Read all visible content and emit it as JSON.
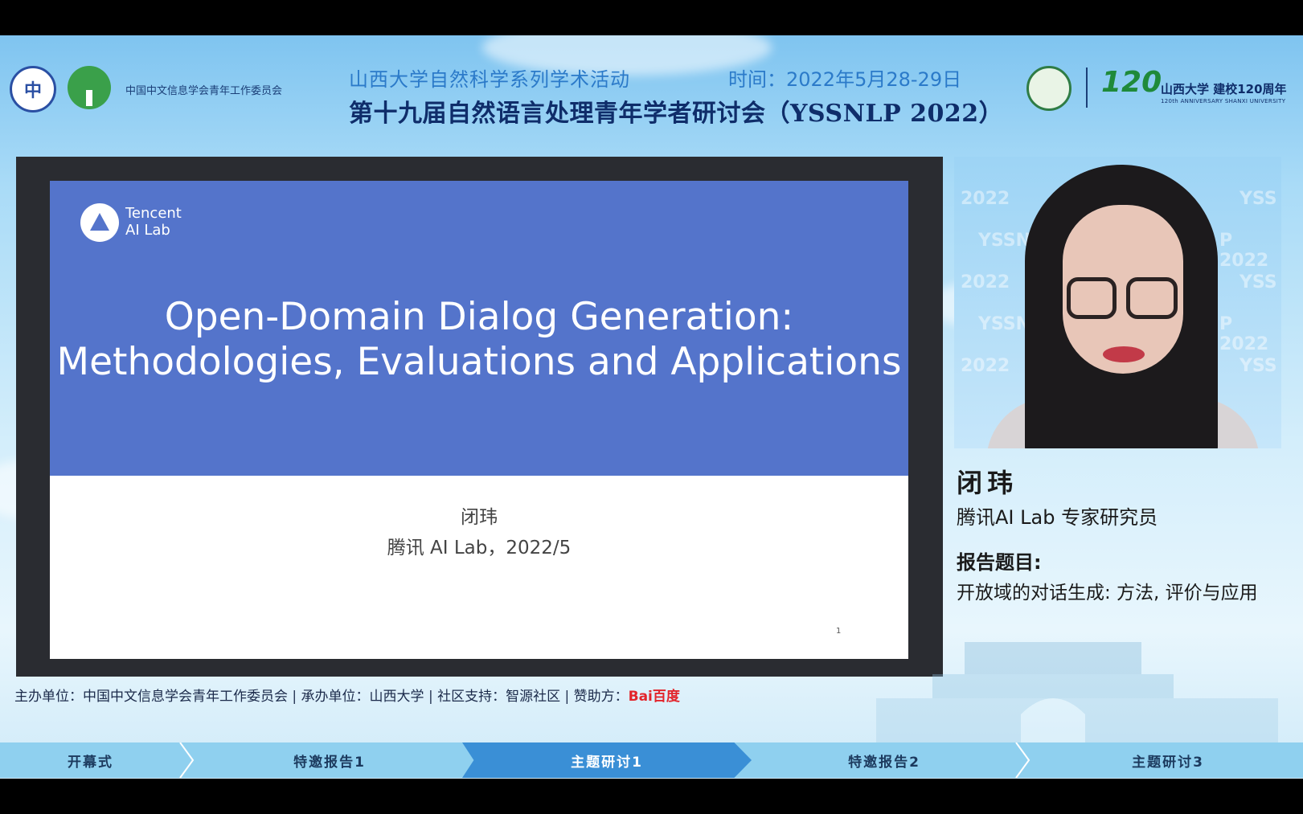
{
  "header": {
    "org_name": "中国中文信息学会青年工作委员会",
    "subtitle": "山西大学自然科学系列学术活动",
    "time": "时间：2022年5月28-29日",
    "title": "第十九届自然语言处理青年学者研讨会（YSSNLP 2022）",
    "anniv_number": "120",
    "anniv_text": "山西大学 建校120周年",
    "anniv_en": "120th ANNIVERSARY SHANXI UNIVERSITY"
  },
  "slide": {
    "brand_line1": "Tencent",
    "brand_line2": "AI Lab",
    "title_line1": "Open-Domain Dialog Generation:",
    "title_line2": "Methodologies, Evaluations and Applications",
    "author": "闭玮",
    "affiliation": "腾讯 AI Lab，2022/5",
    "page_number": "1"
  },
  "speaker": {
    "name": "闭玮",
    "position": "腾讯AI Lab  专家研究员",
    "topic_label": "报告题目:",
    "topic": "开放域的对话生成: 方法, 评价与应用"
  },
  "footer": {
    "text": "主办单位：中国中文信息学会青年工作委员会 | 承办单位：山西大学 | 社区支持：智源社区 | 赞助方：",
    "sponsor": "Bai百度"
  },
  "nav": {
    "items": [
      "开幕式",
      "特邀报告1",
      "主题研讨1",
      "特邀报告2",
      "主题研讨3"
    ],
    "active_index": 2
  },
  "colors": {
    "slide_blue": "#5474cb",
    "nav_active": "#3a8fd6",
    "title_navy": "#0f2d6a"
  }
}
